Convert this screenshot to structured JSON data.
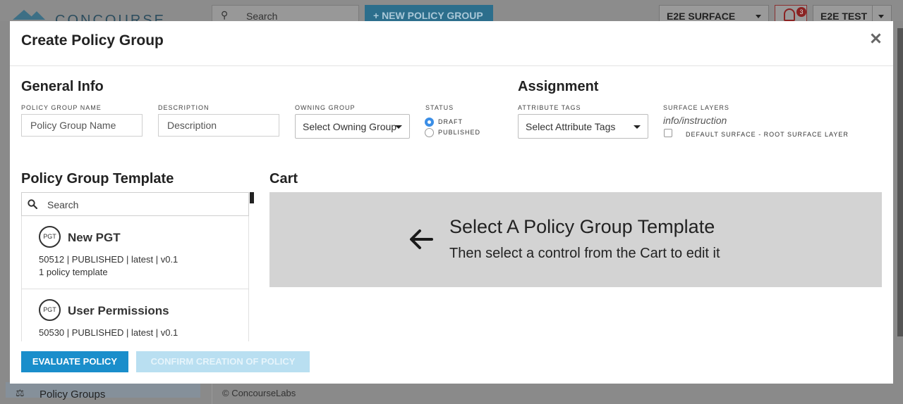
{
  "background_app": {
    "logo_text": "CONCOURSE",
    "search_label": "Search",
    "new_policy_group_label": "+ NEW POLICY GROUP",
    "surface_label": "E2E SURFACE",
    "notification_count": "3",
    "user_label": "E2E TEST",
    "sidebar_item_label": "Policy Groups",
    "footer_text": "© ConcourseLabs"
  },
  "modal": {
    "title": "Create Policy Group",
    "general_info": {
      "heading": "General Info",
      "name_label": "POLICY GROUP NAME",
      "name_placeholder": "Policy Group Name",
      "description_label": "DESCRIPTION",
      "description_placeholder": "Description",
      "owning_group_label": "OWNING GROUP",
      "owning_group_value": "Select Owning Group",
      "status_label": "STATUS",
      "status_options": [
        {
          "label": "DRAFT",
          "checked": true
        },
        {
          "label": "PUBLISHED",
          "checked": false
        }
      ]
    },
    "assignment": {
      "heading": "Assignment",
      "attribute_tags_label": "ATTRIBUTE TAGS",
      "attribute_tags_value": "Select Attribute Tags",
      "surface_layers_label": "SURFACE LAYERS",
      "surface_layers_hint": "info/instruction",
      "surface_layer_option": "DEFAULT SURFACE - ROOT SURFACE LAYER",
      "surface_layer_checked": false
    },
    "template": {
      "heading": "Policy Group Template",
      "search_placeholder": "Search",
      "items": [
        {
          "icon": "PGT",
          "name": "New PGT",
          "meta": "50512 | PUBLISHED | latest | v0.1",
          "count": "1 policy template"
        },
        {
          "icon": "PGT",
          "name": "User Permissions",
          "meta": "50530 | PUBLISHED | latest | v0.1",
          "count": ""
        }
      ]
    },
    "cart": {
      "heading": "Cart",
      "title": "Select A Policy Group Template",
      "subtitle": "Then select a control from the Cart to edit it"
    },
    "buttons": {
      "evaluate": "EVALUATE POLICY",
      "confirm": "CONFIRM CREATION OF POLICY"
    }
  },
  "colors": {
    "primary": "#1a8ecb",
    "primary_disabled": "#b9dff1",
    "radio_checked": "#3b8ee6",
    "cart_background": "#d3d3d3",
    "overlay": "#7a7a7a"
  }
}
